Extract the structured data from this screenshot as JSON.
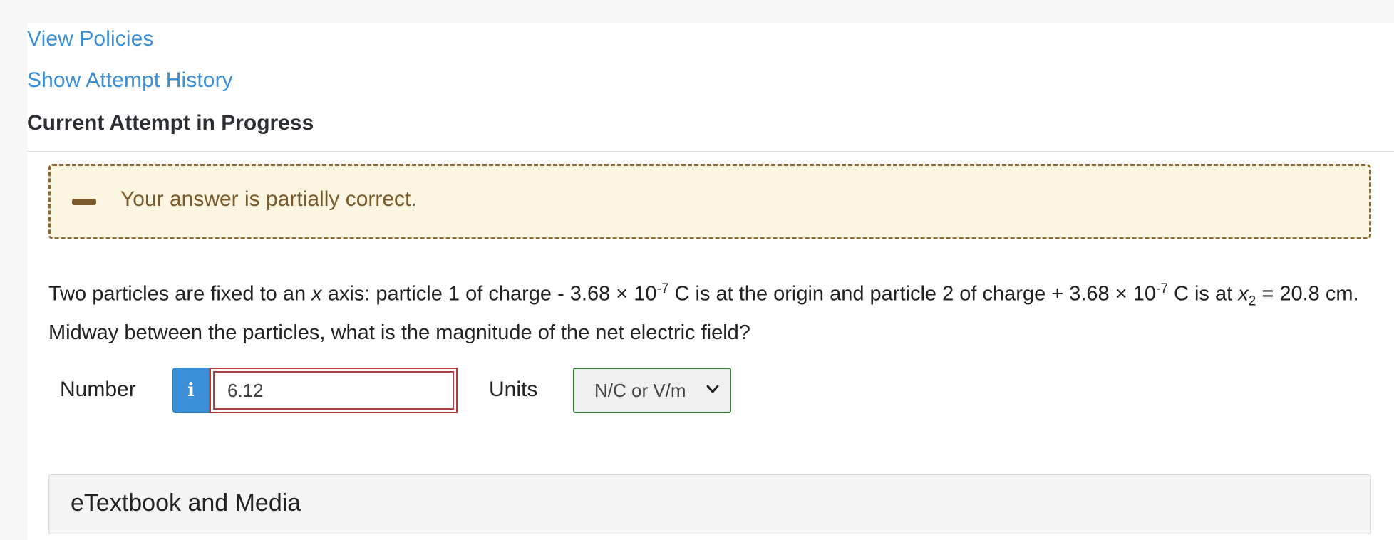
{
  "links": {
    "view_policies": "View Policies",
    "show_attempt_history": "Show Attempt History"
  },
  "attempt_heading": "Current Attempt in Progress",
  "feedback": {
    "message": "Your answer is partially correct.",
    "icon": "minus-icon"
  },
  "question": {
    "part1": "Two particles are fixed to an ",
    "axis_var": "x",
    "part2": " axis: particle 1 of charge - 3.68 × 10",
    "exp1": "-7",
    "part3": " C is at the origin and particle 2 of charge + 3.68 × 10",
    "exp2": "-7",
    "part4": " C is at ",
    "pos_var": "x",
    "pos_sub": "2",
    "part5": " = 20.8 cm. Midway between the particles, what is the magnitude of the net electric field?"
  },
  "answer": {
    "number_label": "Number",
    "info_glyph": "i",
    "number_value": "6.12",
    "units_label": "Units",
    "units_value": "N/C or V/m"
  },
  "media": {
    "title": "eTextbook and Media"
  },
  "colors": {
    "link": "#3a8fd6",
    "feedback_bg": "#fbf5e1",
    "feedback_border": "#8a6a32",
    "input_error": "#b23b3b",
    "select_border": "#3f7a3f",
    "info_button": "#3a8fd6"
  }
}
